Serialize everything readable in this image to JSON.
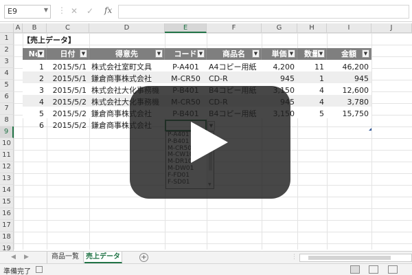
{
  "formula_bar": {
    "name_box": "E9",
    "fx": "fx",
    "cancel": "✕",
    "enter": "✓"
  },
  "columns": [
    "A",
    "B",
    "C",
    "D",
    "E",
    "F",
    "G",
    "H",
    "I",
    "J"
  ],
  "rows": [
    "1",
    "2",
    "3",
    "4",
    "5",
    "6",
    "7",
    "8",
    "9",
    "10",
    "11",
    "12",
    "13",
    "14",
    "15",
    "16",
    "17",
    "18",
    "19"
  ],
  "sheet": {
    "title": "【売上データ】",
    "headers": [
      "No",
      "日付",
      "得意先",
      "コード",
      "商品名",
      "単価",
      "数量",
      "金額"
    ],
    "data": [
      [
        "1",
        "2015/5/1",
        "株式会社室町文具",
        "P-A401",
        "A4コピー用紙",
        "4,200",
        "11",
        "46,200"
      ],
      [
        "2",
        "2015/5/1",
        "鎌倉商事株式会社",
        "M-CR50",
        "CD-R",
        "945",
        "1",
        "945"
      ],
      [
        "3",
        "2015/5/1",
        "株式会社大化事務機",
        "P-B401",
        "B4コピー用紙",
        "3,150",
        "4",
        "12,600"
      ],
      [
        "4",
        "2015/5/2",
        "株式会社大化事務機",
        "M-CR50",
        "CD-R",
        "945",
        "4",
        "3,780"
      ],
      [
        "5",
        "2015/5/2",
        "鎌倉商事株式会社",
        "P-B401",
        "B4コピー用紙",
        "3,150",
        "5",
        "15,750"
      ]
    ],
    "row6": [
      "6",
      "2015/5/2",
      "鎌倉商事株式会社"
    ]
  },
  "dropdown_items": [
    "P-A401",
    "P-B401",
    "M-CR50",
    "M-CW10",
    "M-DR10",
    "M-DW01",
    "F-FD01",
    "F-SD01"
  ],
  "tabs": [
    "商品一覧",
    "売上データ"
  ],
  "add_sheet": "+",
  "status_text": "準備完了",
  "colors": {
    "header_fill": "#7f7f7f",
    "band_fill": "#eeeeee",
    "accent": "#217346",
    "overlay": "#1e1e1e"
  }
}
